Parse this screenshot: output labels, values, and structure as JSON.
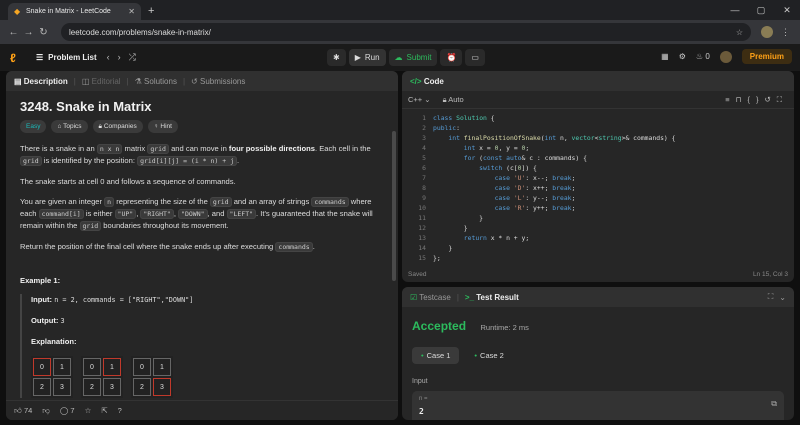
{
  "browser": {
    "tab_title": "Snake in Matrix - LeetCode",
    "url": "leetcode.com/problems/snake-in-matrix/"
  },
  "nav": {
    "problem_list": "Problem List",
    "run": "Run",
    "submit": "Submit",
    "streak": "0",
    "premium": "Premium"
  },
  "left_tabs": [
    "Description",
    "Editorial",
    "Solutions",
    "Submissions"
  ],
  "problem": {
    "title": "3248. Snake in Matrix",
    "tags": [
      "Easy",
      "Topics",
      "Companies",
      "Hint"
    ],
    "p1a": "There is a snake in an ",
    "p1c": "n x n",
    "p1d": " matrix ",
    "p1e": "grid",
    "p1f": " and can move in ",
    "p1g": "four possible directions",
    "p1h": ". Each cell in the ",
    "p1i": "grid",
    "p1j": " is identified by the position: ",
    "p1k": "grid[i][j] = (i * n) + j",
    "p1l": ".",
    "p2": "The snake starts at cell 0 and follows a sequence of commands.",
    "p3a": "You are given an integer ",
    "p3b": "n",
    "p3c": " representing the size of the ",
    "p3d": "grid",
    "p3e": " and an array of strings ",
    "p3f": "commands",
    "p3g": " where each ",
    "p3h": "command[i]",
    "p3i": " is either ",
    "p3j": "\"UP\"",
    "p3k": ", ",
    "p3l": "\"RIGHT\"",
    "p3m": ", ",
    "p3n": "\"DOWN\"",
    "p3o": ", and ",
    "p3p": "\"LEFT\"",
    "p3q": ". It's guaranteed that the snake will remain within the ",
    "p3r": "grid",
    "p3s": " boundaries throughout its movement.",
    "p4a": "Return the position of the final cell where the snake ends up after executing ",
    "p4b": "commands",
    "p4c": ".",
    "example_title": "Example 1:",
    "input_label": "Input:",
    "input_value": "n = 2, commands = [\"RIGHT\",\"DOWN\"]",
    "output_label": "Output:",
    "output_value": "3",
    "explanation_label": "Explanation:",
    "grids": [
      [
        "0",
        "1",
        "2",
        "3"
      ],
      [
        "0",
        "1",
        "2",
        "3"
      ],
      [
        "0",
        "1",
        "2",
        "3"
      ]
    ],
    "likes": "74",
    "comments": "7"
  },
  "code": {
    "title": "Code",
    "lang": "C++",
    "mode": "Auto",
    "saved": "Saved",
    "cursor": "Ln 15, Col 3"
  },
  "result": {
    "tab1": "Testcase",
    "tab2": "Test Result",
    "status": "Accepted",
    "runtime": "Runtime: 2 ms",
    "case1": "Case 1",
    "case2": "Case 2",
    "input_label": "Input",
    "var": "n =",
    "val": "2"
  }
}
